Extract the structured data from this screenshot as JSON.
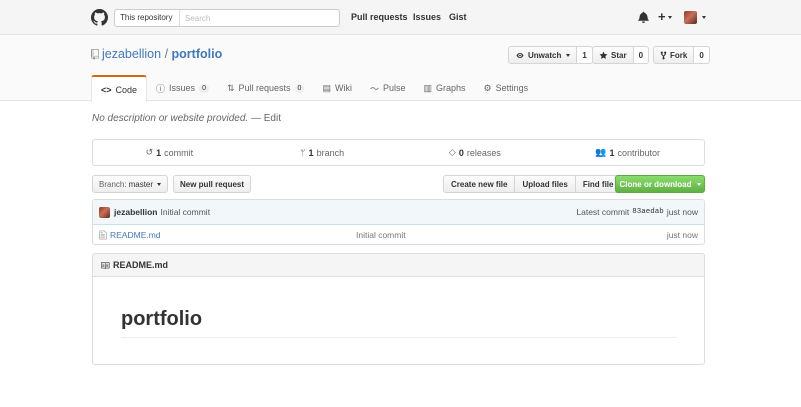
{
  "header": {
    "search_scope": "This repository",
    "search_placeholder": "Search",
    "nav": [
      "Pull requests",
      "Issues",
      "Gist"
    ]
  },
  "repo": {
    "owner": "jezabellion",
    "separator": "/",
    "name": "portfolio",
    "watch_label": "Unwatch",
    "watch_count": "1",
    "star_label": "Star",
    "star_count": "0",
    "fork_label": "Fork",
    "fork_count": "0"
  },
  "tabs": [
    {
      "label": "Code",
      "counter": null
    },
    {
      "label": "Issues",
      "counter": "0"
    },
    {
      "label": "Pull requests",
      "counter": "0"
    },
    {
      "label": "Wiki",
      "counter": null
    },
    {
      "label": "Pulse",
      "counter": null
    },
    {
      "label": "Graphs",
      "counter": null
    },
    {
      "label": "Settings",
      "counter": null
    }
  ],
  "description": {
    "text": "No description or website provided.",
    "dash": "—",
    "edit": "Edit"
  },
  "summary": [
    {
      "num": "1",
      "label": "commit"
    },
    {
      "num": "1",
      "label": "branch"
    },
    {
      "num": "0",
      "label": "releases"
    },
    {
      "num": "1",
      "label": "contributor"
    }
  ],
  "file_nav": {
    "branch_prefix": "Branch:",
    "branch_name": "master",
    "new_pr": "New pull request",
    "create_file": "Create new file",
    "upload_files": "Upload files",
    "find_file": "Find file",
    "clone": "Clone or download"
  },
  "commit_tease": {
    "author": "jezabellion",
    "message": "Initial commit",
    "latest_label": "Latest commit",
    "sha": "83aedab",
    "age": "just now"
  },
  "files": [
    {
      "name": "README.md",
      "message": "Initial commit",
      "age": "just now"
    }
  ],
  "readme": {
    "header": "README.md",
    "h1": "portfolio"
  }
}
